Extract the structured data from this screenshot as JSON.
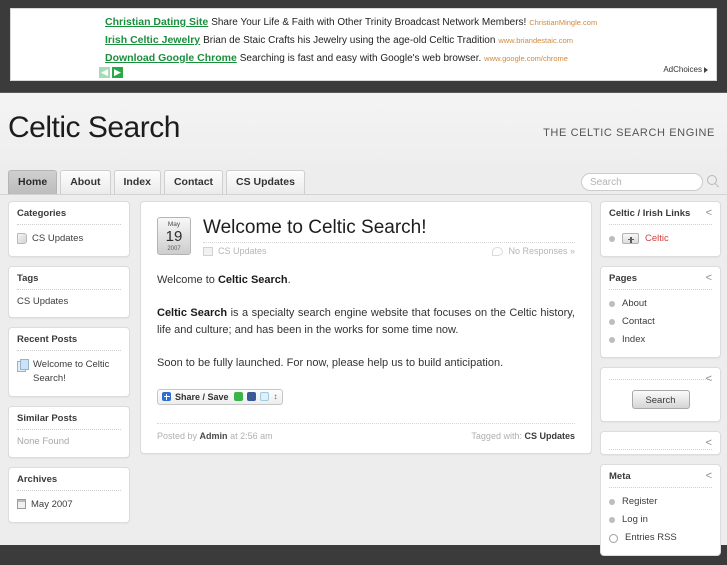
{
  "ads": {
    "rows": [
      {
        "title": "Christian Dating Site",
        "desc": "Share Your Life & Faith with Other Trinity Broadcast Network Members!",
        "url": "ChristianMingle.com"
      },
      {
        "title": "Irish Celtic Jewelry",
        "desc": "Brian de Staic Crafts his Jewelry using the age-old Celtic Tradition",
        "url": "www.briandestaic.com"
      },
      {
        "title": "Download Google Chrome",
        "desc": "Searching is fast and easy with Google's web browser.",
        "url": "www.google.com/chrome"
      }
    ],
    "prev_label": "◀",
    "next_label": "▶",
    "adchoices_label": "AdChoices"
  },
  "header": {
    "title": "Celtic Search",
    "tagline": "THE CELTIC SEARCH ENGINE"
  },
  "nav": {
    "tabs": [
      {
        "label": "Home",
        "active": true
      },
      {
        "label": "About",
        "active": false
      },
      {
        "label": "Index",
        "active": false
      },
      {
        "label": "Contact",
        "active": false
      },
      {
        "label": "CS Updates",
        "active": false
      }
    ],
    "search_placeholder": "Search",
    "search_value": ""
  },
  "sidebar_left": {
    "categories": {
      "title": "Categories",
      "items": [
        "CS Updates"
      ]
    },
    "tags": {
      "title": "Tags",
      "items": [
        "CS Updates"
      ]
    },
    "recent_posts": {
      "title": "Recent Posts",
      "items": [
        "Welcome to Celtic Search!"
      ]
    },
    "similar_posts": {
      "title": "Similar Posts",
      "empty_text": "None Found"
    },
    "archives": {
      "title": "Archives",
      "items": [
        "May 2007"
      ]
    }
  },
  "post": {
    "date": {
      "month": "May",
      "day": "19",
      "year": "2007"
    },
    "title": "Welcome to Celtic Search!",
    "category": "CS Updates",
    "responses": "No Responses »",
    "paragraphs": [
      "Welcome to <b>Celtic Search</b>.",
      "<b>Celtic Search</b> is a specialty search engine website that focuses on the Celtic history, life and culture; and has been in the works for some time now.",
      "Soon to be fully launched. For now, please help us to build anticipation."
    ],
    "share_label": "Share / Save",
    "posted_by_prefix": "Posted by",
    "posted_by_author": "Admin",
    "posted_at": "at 2:56 am",
    "tagged_prefix": "Tagged with:",
    "tagged_value": "CS Updates"
  },
  "sidebar_right": {
    "links": {
      "title": "Celtic / Irish Links",
      "items": [
        "Celtic"
      ]
    },
    "pages": {
      "title": "Pages",
      "items": [
        "About",
        "Contact",
        "Index"
      ]
    },
    "search_widget": {
      "title": "",
      "button_label": "Search"
    },
    "blank_widget": {
      "title": ""
    },
    "meta": {
      "title": "Meta",
      "items": [
        "Register",
        "Log in",
        "Entries RSS"
      ]
    },
    "collapse_icon": "<"
  },
  "colors": {
    "page_background": "#3b3b3b",
    "content_background": "#ededed",
    "widget_background": "#ffffff",
    "ad_link": "#1a8f3c",
    "ad_url": "#cf8a3e",
    "link_red": "#d4403e"
  }
}
